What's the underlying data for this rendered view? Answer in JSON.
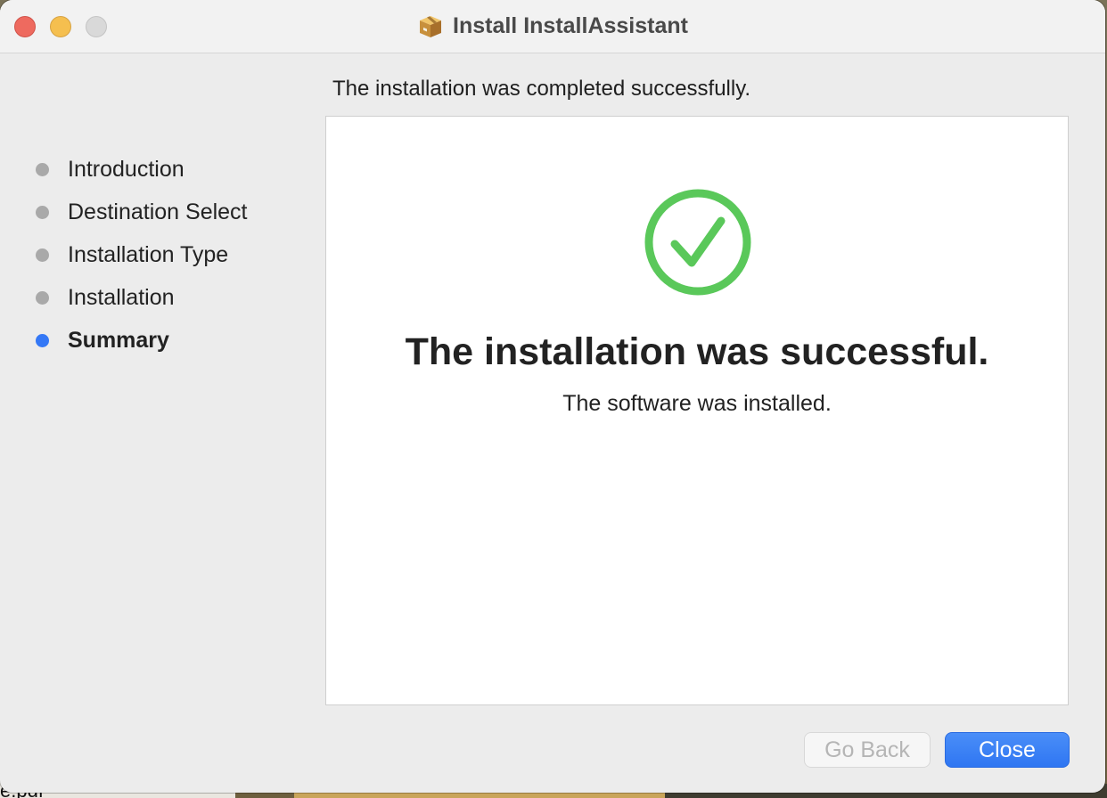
{
  "window": {
    "title": "Install InstallAssistant"
  },
  "header": {
    "caption": "The installation was completed successfully."
  },
  "sidebar": {
    "steps": [
      {
        "label": "Introduction",
        "active": false
      },
      {
        "label": "Destination Select",
        "active": false
      },
      {
        "label": "Installation Type",
        "active": false
      },
      {
        "label": "Installation",
        "active": false
      },
      {
        "label": "Summary",
        "active": true
      }
    ]
  },
  "main": {
    "status_icon": "checkmark-circle-icon",
    "headline": "The installation was successful.",
    "message": "The software was installed."
  },
  "buttons": {
    "go_back": "Go Back",
    "close": "Close"
  },
  "desktop": {
    "partial_label": "e.pdf"
  },
  "colors": {
    "accent": "#3478f6",
    "success": "#5ac85a",
    "inactive_dot": "#a9a9a9"
  }
}
